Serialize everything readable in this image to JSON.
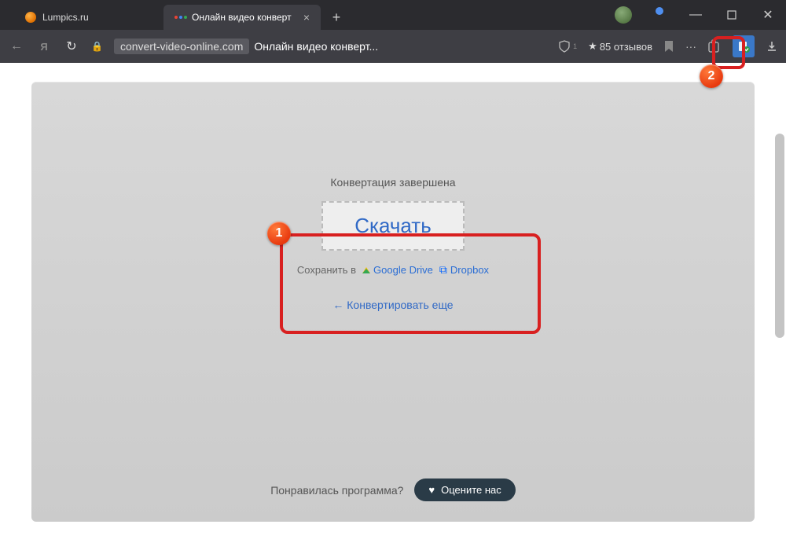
{
  "tabs": {
    "inactive": {
      "title": "Lumpics.ru"
    },
    "active": {
      "title": "Онлайн видео конверт"
    }
  },
  "addressbar": {
    "host": "convert-video-online.com",
    "title": "Онлайн видео конверт...",
    "reviews": "85 отзывов"
  },
  "panel": {
    "status": "Конвертация завершена",
    "download": "Скачать",
    "save_label": "Сохранить в",
    "gdrive": "Google Drive",
    "dropbox": "Dropbox",
    "convert_again": "← Конвертировать еще"
  },
  "rate": {
    "question": "Понравилась программа?",
    "button": "Оцените нас"
  },
  "annotations": {
    "one": "1",
    "two": "2"
  }
}
